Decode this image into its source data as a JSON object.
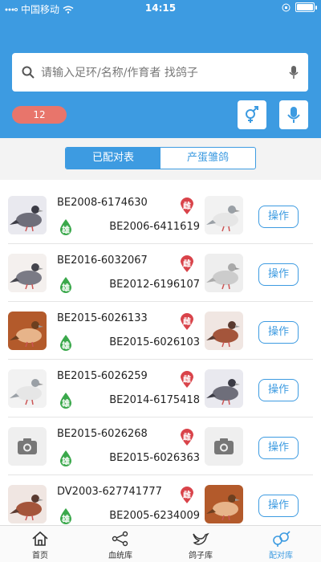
{
  "status_bar": {
    "carrier": "中国移动",
    "time": "14:15"
  },
  "search": {
    "placeholder": "请输入足环/名称/作育者 找鸽子"
  },
  "count_badge": "12",
  "segments": [
    {
      "label": "已配对表",
      "active": true
    },
    {
      "label": "产蛋雏鸽",
      "active": false
    }
  ],
  "pairs": [
    {
      "male_ring": "BE2008-6174630",
      "male_tag": "雄",
      "female_ring": "BE2006-6411619",
      "female_tag": "雌",
      "action": "操作",
      "left_thumb": "pigeon-photo",
      "right_thumb": "pigeon-photo"
    },
    {
      "male_ring": "BE2016-6032067",
      "male_tag": "雄",
      "female_ring": "BE2012-6196107",
      "female_tag": "雌",
      "action": "操作",
      "left_thumb": "pigeon-photo",
      "right_thumb": "pigeon-photo"
    },
    {
      "male_ring": "BE2015-6026133",
      "male_tag": "雄",
      "female_ring": "BE2015-6026103",
      "female_tag": "雌",
      "action": "操作",
      "left_thumb": "pigeon-photo",
      "right_thumb": "pigeon-photo"
    },
    {
      "male_ring": "BE2015-6026259",
      "male_tag": "雄",
      "female_ring": "BE2014-6175418",
      "female_tag": "雌",
      "action": "操作",
      "left_thumb": "pigeon-photo",
      "right_thumb": "pigeon-photo"
    },
    {
      "male_ring": "BE2015-6026268",
      "male_tag": "雄",
      "female_ring": "BE2015-6026363",
      "female_tag": "雌",
      "action": "操作",
      "left_thumb": "camera-placeholder",
      "right_thumb": "camera-placeholder"
    },
    {
      "male_ring": "DV2003-627741777",
      "male_tag": "雄",
      "female_ring": "BE2005-6234009",
      "female_tag": "雌",
      "action": "操作",
      "left_thumb": "pigeon-photo",
      "right_thumb": "pigeon-photo"
    }
  ],
  "tabs": [
    {
      "label": "首页",
      "icon": "home-icon",
      "active": false
    },
    {
      "label": "血统库",
      "icon": "pedigree-icon",
      "active": false
    },
    {
      "label": "鸽子库",
      "icon": "bird-icon",
      "active": false
    },
    {
      "label": "配对库",
      "icon": "pairing-icon",
      "active": true
    }
  ],
  "colors": {
    "primary": "#3d9be1",
    "badge": "#e8756b",
    "male": "#3aa84b",
    "female": "#d9434a"
  }
}
